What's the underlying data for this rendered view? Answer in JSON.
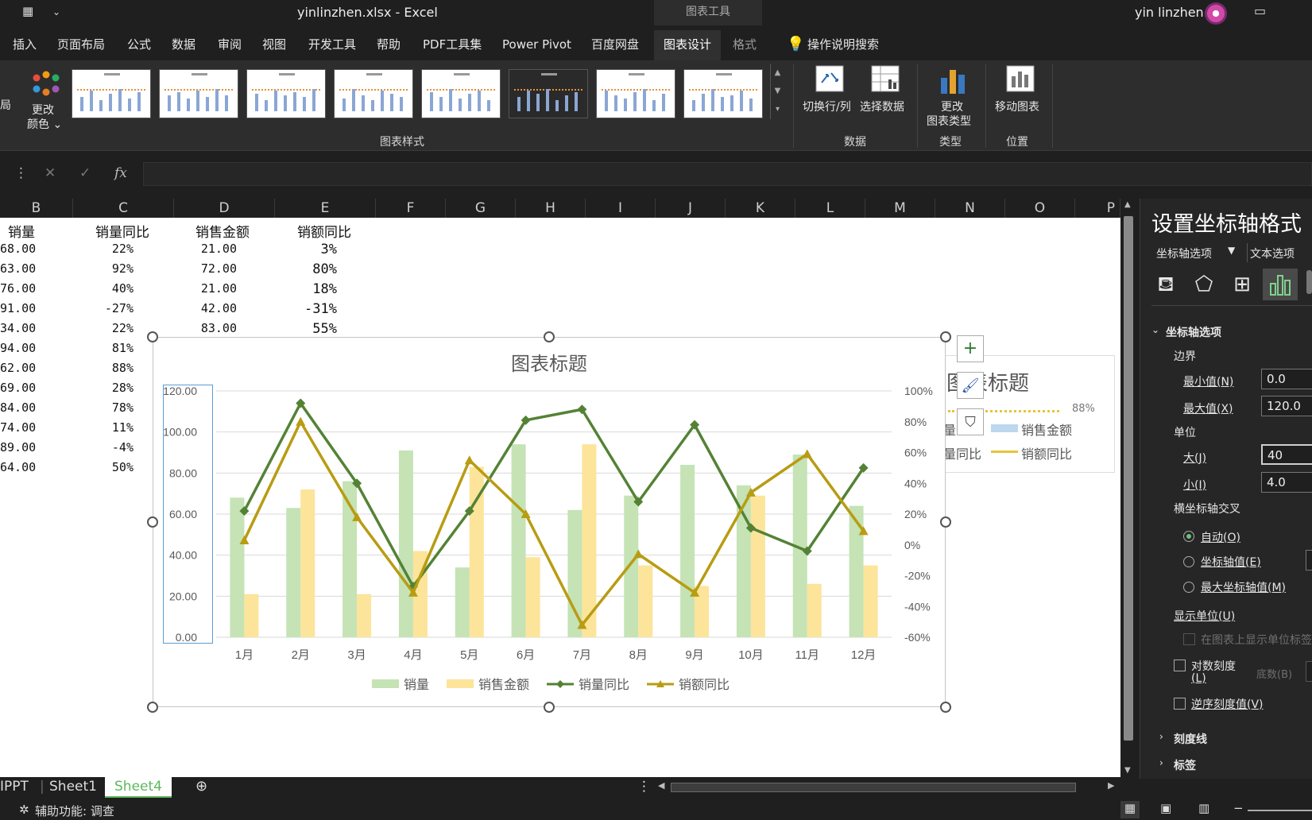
{
  "titlebar": {
    "filename": "yinlinzhen.xlsx",
    "separator": "-",
    "app": "Excel",
    "tools": "图表工具",
    "user": "yin linzhen"
  },
  "tabs": [
    "插入",
    "页面布局",
    "公式",
    "数据",
    "审阅",
    "视图",
    "开发工具",
    "帮助",
    "PDF工具集",
    "Power Pivot",
    "百度网盘",
    "图表设计",
    "格式"
  ],
  "tell_me": "操作说明搜索",
  "ribbon": {
    "cut_left": "局",
    "change_colors": [
      "更改",
      "颜色 ⌄"
    ],
    "chart_styles_label": "图表样式",
    "switch_row_col": "切换行/列",
    "select_data": "选择数据",
    "data_group": "数据",
    "change_type": [
      "更改",
      "图表类型"
    ],
    "type_group": "类型",
    "move_chart": "移动图表",
    "location_group": "位置"
  },
  "formula": {
    "fx": "fx",
    "cancel": "✕",
    "enter": "✓"
  },
  "columns": [
    "B",
    "C",
    "D",
    "E",
    "F",
    "G",
    "H",
    "I",
    "J",
    "K",
    "L",
    "M",
    "N",
    "O",
    "P"
  ],
  "table": {
    "headers": [
      "销量",
      "销量同比",
      "销售金额",
      "销额同比"
    ],
    "rows": [
      [
        "68.00",
        "22%",
        "21.00",
        "3%"
      ],
      [
        "63.00",
        "92%",
        "72.00",
        "80%"
      ],
      [
        "76.00",
        "40%",
        "21.00",
        "18%"
      ],
      [
        "91.00",
        "-27%",
        "42.00",
        "-31%"
      ],
      [
        "34.00",
        "22%",
        "83.00",
        "55%"
      ],
      [
        "94.00",
        "81%",
        "",
        ""
      ],
      [
        "62.00",
        "88%",
        "",
        ""
      ],
      [
        "69.00",
        "28%",
        "",
        ""
      ],
      [
        "84.00",
        "78%",
        "",
        ""
      ],
      [
        "74.00",
        "11%",
        "",
        ""
      ],
      [
        "89.00",
        "-4%",
        "",
        ""
      ],
      [
        "64.00",
        "50%",
        "",
        ""
      ]
    ]
  },
  "chart_data": {
    "type": "bar",
    "title": "图表标题",
    "categories": [
      "1月",
      "2月",
      "3月",
      "4月",
      "5月",
      "6月",
      "7月",
      "8月",
      "9月",
      "10月",
      "11月",
      "12月"
    ],
    "y_ticks": [
      "0.00",
      "20.00",
      "40.00",
      "60.00",
      "80.00",
      "100.00",
      "120.00"
    ],
    "y2_ticks": [
      "-60%",
      "-40%",
      "-20%",
      "0%",
      "20%",
      "40%",
      "60%",
      "80%",
      "100%"
    ],
    "ylim": [
      0,
      120
    ],
    "y2lim": [
      -60,
      100
    ],
    "grid": true,
    "legend": "bottom",
    "series": [
      {
        "name": "销量",
        "type": "bar",
        "axis": "primary",
        "color": "#c5e3b5",
        "values": [
          68,
          63,
          76,
          91,
          34,
          94,
          62,
          69,
          84,
          74,
          89,
          64
        ]
      },
      {
        "name": "销售金额",
        "type": "bar",
        "axis": "primary",
        "color": "#fce49a",
        "values": [
          21,
          72,
          21,
          42,
          83,
          39,
          94,
          35,
          25,
          69,
          26,
          35
        ]
      },
      {
        "name": "销量同比",
        "type": "line",
        "axis": "secondary",
        "marker": "diamond",
        "color": "#548235",
        "values": [
          22,
          92,
          40,
          -27,
          22,
          81,
          88,
          28,
          78,
          11,
          -4,
          50
        ]
      },
      {
        "name": "销额同比",
        "type": "line",
        "axis": "secondary",
        "marker": "triangle",
        "color": "#b89c12",
        "values": [
          3,
          80,
          18,
          -31,
          55,
          20,
          -52,
          -6,
          -31,
          34,
          59,
          9
        ]
      }
    ]
  },
  "ghost": {
    "title": "图表标题",
    "pct": "88%",
    "l1": "量",
    "l2": "销售金额",
    "l3": "量同比",
    "l4": "销额同比"
  },
  "sheets": [
    "IPPT",
    "Sheet1",
    "Sheet4"
  ],
  "status": {
    "accessibility": "辅助功能: 调查"
  },
  "panel": {
    "title": "设置坐标轴格式",
    "axis_options_tab": "坐标轴选项",
    "text_options_tab": "文本选项",
    "section": "坐标轴选项",
    "bounds": "边界",
    "min_label": "最小值(N)",
    "min_value": "0.0",
    "max_label": "最大值(X)",
    "max_value": "120.0",
    "units": "单位",
    "major_label": "大(J)",
    "major_value": "40",
    "minor_label": "小(I)",
    "minor_value": "4.0",
    "cross": "横坐标轴交叉",
    "auto": "自动(O)",
    "axis_value": "坐标轴值(E)",
    "max_axis_value": "最大坐标轴值(M)",
    "display_units": "显示单位(U)",
    "show_units_label": "在图表上显示单位标签",
    "log_scale": "对数刻度",
    "log_scale_key": "(L)",
    "base": "底数(B)",
    "reverse": "逆序刻度值(V)",
    "tick_marks": "刻度线",
    "labels": "标签"
  }
}
